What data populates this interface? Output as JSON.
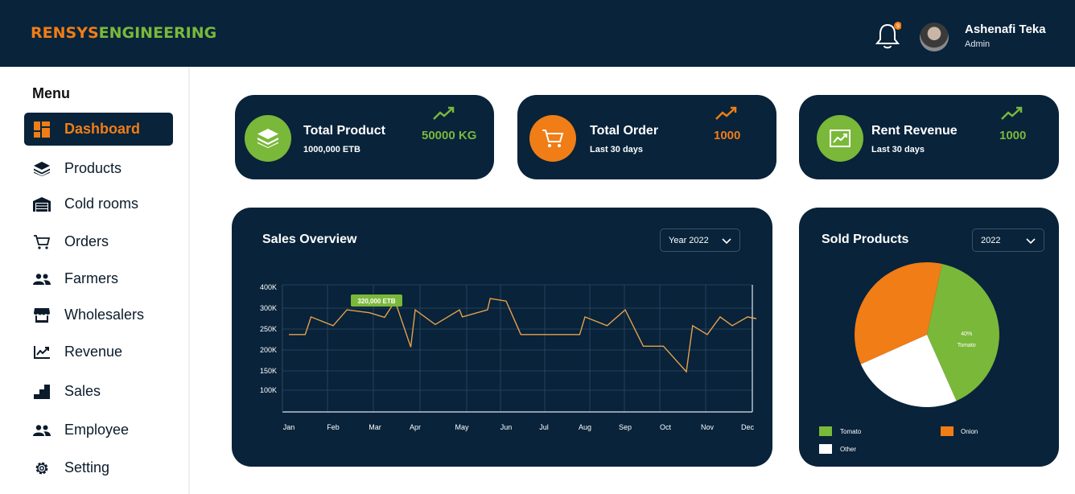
{
  "header": {
    "brand_part1": "RENSYS",
    "brand_part2": "ENGINEERING",
    "notification_count": "9",
    "user_name": "Ashenafi Teka",
    "user_role": "Admin"
  },
  "sidebar": {
    "menu_title": "Menu",
    "items": [
      {
        "label": "Dashboard",
        "icon": "dashboard-icon",
        "active": true
      },
      {
        "label": "Products",
        "icon": "layers-icon"
      },
      {
        "label": "Cold rooms",
        "icon": "warehouse-icon"
      },
      {
        "label": "Orders",
        "icon": "cart-icon"
      },
      {
        "label": "Farmers",
        "icon": "people-icon"
      },
      {
        "label": "Wholesalers",
        "icon": "store-icon"
      },
      {
        "label": "Revenue",
        "icon": "chart-line-icon"
      },
      {
        "label": "Sales",
        "icon": "stairs-icon"
      },
      {
        "label": "Employee",
        "icon": "people-icon"
      },
      {
        "label": "Setting",
        "icon": "gear-icon"
      }
    ]
  },
  "stats": [
    {
      "title": "Total Product",
      "sub": "1000,000 ETB",
      "value": "50000 KG",
      "icon": "layers-icon",
      "color": "#7ab83a"
    },
    {
      "title": "Total Order",
      "sub": "Last 30 days",
      "value": "1000",
      "icon": "cart-icon",
      "color": "#f07d16"
    },
    {
      "title": "Rent Revenue",
      "sub": "Last 30 days",
      "value": "1000",
      "icon": "chart-up-icon",
      "color": "#7ab83a"
    }
  ],
  "sales": {
    "title": "Sales Overview",
    "select": "Year 2022",
    "tooltip": "320,000 ETB"
  },
  "sold": {
    "title": "Sold Products",
    "select": "2022"
  },
  "colors": {
    "navy": "#08233a",
    "green": "#7ab83a",
    "orange": "#f07d16",
    "line": "#e7a04c"
  },
  "chart_data": [
    {
      "type": "line",
      "title": "Sales Overview",
      "x": [
        "Jan",
        "",
        "Feb",
        "",
        "Mar",
        "",
        "Apr",
        "",
        "May",
        "",
        "Jun",
        "",
        "Jul",
        "",
        "Aug",
        "",
        "Sep",
        "",
        "Oct",
        "",
        "Nov",
        "",
        "Dec"
      ],
      "x_tick_labels": [
        "Jan",
        "Feb",
        "Mar",
        "Apr",
        "May",
        "Jun",
        "Jul",
        "Aug",
        "Sep",
        "Oct",
        "Nov",
        "Dec"
      ],
      "y_tick_labels": [
        "400K",
        "300K",
        "250K",
        "200K",
        "150K",
        "100K"
      ],
      "y_ticks": [
        400,
        300,
        250,
        200,
        150,
        100
      ],
      "series": [
        {
          "values_k": [
            237,
            237,
            279,
            258,
            296,
            289,
            278,
            334,
            207,
            296,
            261,
            296,
            279,
            296,
            346,
            334,
            237,
            237,
            237,
            237,
            279,
            258,
            296,
            209,
            209,
            148,
            258,
            237,
            279,
            258,
            279,
            275
          ]
        }
      ],
      "x_positions": [
        0,
        0.37,
        0.5,
        1.0,
        1.33,
        1.87,
        2.24,
        2.5,
        2.89,
        3.0,
        3.43,
        3.95,
        4.01,
        4.58,
        4.64,
        5.0,
        5.39,
        5.75,
        6.45,
        6.87,
        7.0,
        7.55,
        8.0,
        8.45,
        8.95,
        9.5,
        9.65,
        10.0,
        10.32,
        10.62,
        11.0,
        11.22
      ]
    },
    {
      "type": "pie",
      "title": "Sold Products",
      "categories": [
        "Tomato",
        "Other",
        "Onion"
      ],
      "values": [
        40,
        25,
        35
      ],
      "labels": [
        "40%",
        "25%",
        "35%"
      ]
    }
  ]
}
